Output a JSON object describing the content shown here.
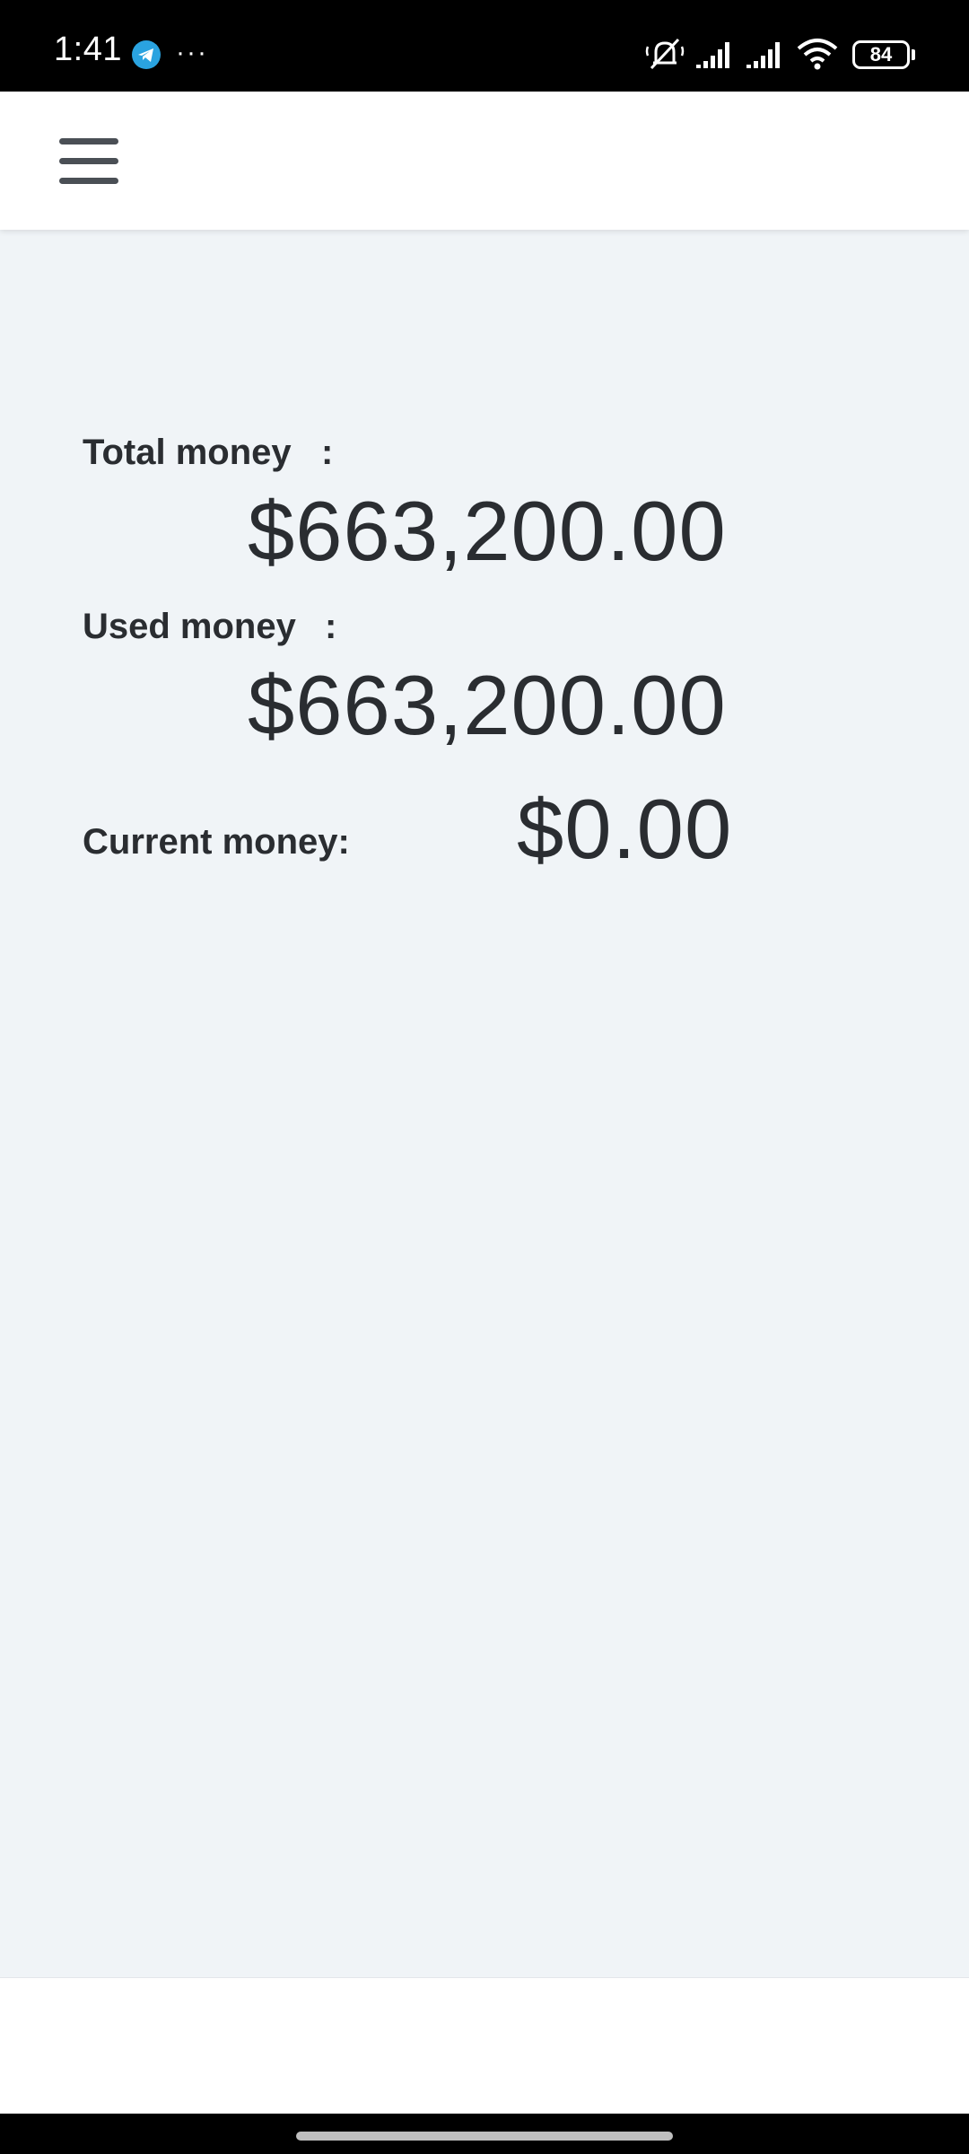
{
  "status_bar": {
    "time": "1:41",
    "more": "···",
    "battery": "84",
    "icons": [
      "telegram-icon",
      "silent-icon",
      "signal-icon",
      "signal-icon",
      "wifi-icon",
      "battery-icon"
    ]
  },
  "header": {
    "menu_icon": "hamburger-menu-icon"
  },
  "summary": {
    "total_label": "Total money",
    "total_colon": ":",
    "total_value": "$663,200.00",
    "used_label": "Used money",
    "used_colon": ":",
    "used_value": "$663,200.00",
    "current_label": "Current money:",
    "current_value": "$0.00"
  },
  "colors": {
    "background": "#f0f4f7",
    "text": "#2a2d31",
    "header": "#ffffff"
  }
}
